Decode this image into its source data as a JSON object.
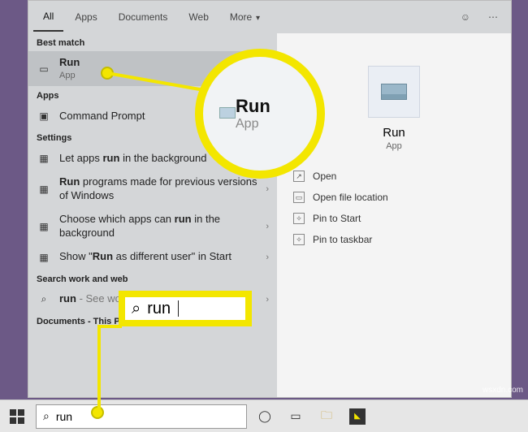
{
  "topbar": {
    "tabs": {
      "all": "All",
      "apps": "Apps",
      "documents": "Documents",
      "web": "Web",
      "more": "More"
    }
  },
  "sections": {
    "best_match": "Best match",
    "apps": "Apps",
    "settings": "Settings",
    "work_web": "Search work and web",
    "documents": "Documents - This PC (3+)"
  },
  "results": {
    "best": {
      "title": "Run",
      "subtitle": "App"
    },
    "app1": "Command Prompt",
    "s1_a": "Let apps ",
    "s1_b": "run",
    "s1_c": " in the background",
    "s2_a": "Run",
    "s2_b": " programs made for previous versions of Windows",
    "s3_a": "Choose which apps can ",
    "s3_b": "run",
    "s3_c": " in the background",
    "s4_a": "Show \"",
    "s4_b": "Run",
    "s4_c": " as different user\" in Start",
    "web_a": "run",
    "web_b": " - See work and web results"
  },
  "details": {
    "title": "Run",
    "subtitle": "App",
    "actions": {
      "open": "Open",
      "openloc": "Open file location",
      "pinstart": "Pin to Start",
      "pintask": "Pin to taskbar"
    }
  },
  "callout": {
    "title": "Run",
    "subtitle": "App",
    "zoom_search": "run"
  },
  "search": {
    "value": "run"
  },
  "watermark": "wsxdn.com"
}
